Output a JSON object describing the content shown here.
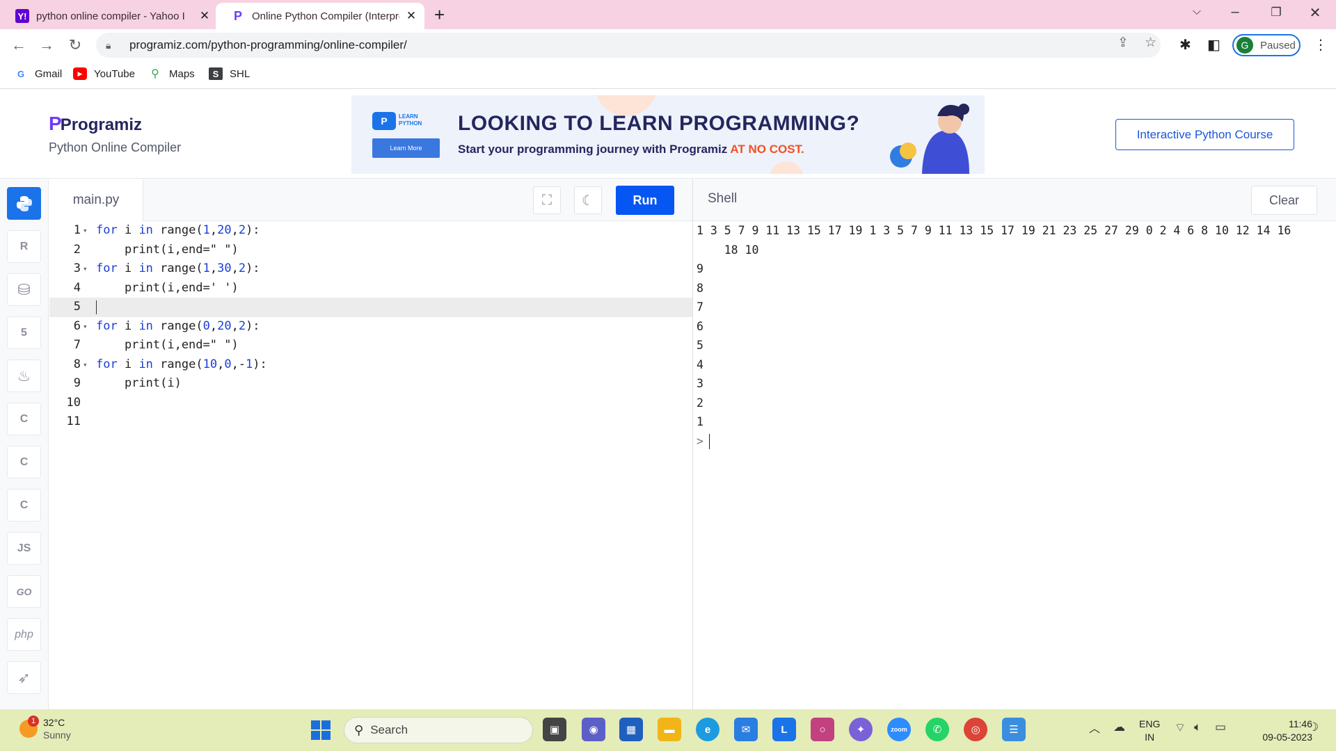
{
  "browser": {
    "tabs": [
      {
        "title": "python online compiler - Yahoo I",
        "favicon": "Y!",
        "active": false
      },
      {
        "title": "Online Python Compiler (Interpre",
        "favicon": "P",
        "active": true
      }
    ],
    "url": "programiz.com/python-programming/online-compiler/",
    "profile_initial": "G",
    "profile_status": "Paused",
    "bookmarks": [
      {
        "label": "Gmail",
        "icon": "google-icon"
      },
      {
        "label": "YouTube",
        "icon": "youtube-icon"
      },
      {
        "label": "Maps",
        "icon": "maps-icon"
      },
      {
        "label": "SHL",
        "icon": "shl-icon"
      }
    ]
  },
  "site": {
    "logo": "Programiz",
    "subtitle": "Python Online Compiler",
    "banner": {
      "badge_text": "LEARN PYTHON",
      "learn_button": "Learn More",
      "headline": "LOOKING TO LEARN PROGRAMMING?",
      "subline": "Start your programming journey with Programiz",
      "highlight": "AT NO COST."
    },
    "course_button": "Interactive Python Course"
  },
  "sidebar": {
    "languages": [
      {
        "name": "python",
        "label": "",
        "active": true
      },
      {
        "name": "r",
        "label": "R",
        "active": false
      },
      {
        "name": "sql",
        "label": "",
        "active": false
      },
      {
        "name": "html",
        "label": "5",
        "active": false
      },
      {
        "name": "java",
        "label": "",
        "active": false
      },
      {
        "name": "c",
        "label": "C",
        "active": false
      },
      {
        "name": "cpp",
        "label": "C",
        "active": false
      },
      {
        "name": "csharp",
        "label": "C",
        "active": false
      },
      {
        "name": "javascript",
        "label": "JS",
        "active": false
      },
      {
        "name": "go",
        "label": "GO",
        "active": false
      },
      {
        "name": "php",
        "label": "php",
        "active": false
      },
      {
        "name": "swift",
        "label": "",
        "active": false
      }
    ]
  },
  "editor": {
    "filename": "main.py",
    "run_label": "Run",
    "current_line": 5,
    "lines": [
      {
        "n": "1",
        "fold": true,
        "code": [
          {
            "t": "for",
            "c": "kw"
          },
          {
            "t": " i "
          },
          {
            "t": "in",
            "c": "kw"
          },
          {
            "t": " range("
          },
          {
            "t": "1",
            "c": "num"
          },
          {
            "t": ","
          },
          {
            "t": "20",
            "c": "num"
          },
          {
            "t": ","
          },
          {
            "t": "2",
            "c": "num"
          },
          {
            "t": "):"
          }
        ]
      },
      {
        "n": "2",
        "fold": false,
        "code": [
          {
            "t": "    print(i,end=\" \")"
          }
        ]
      },
      {
        "n": "3",
        "fold": true,
        "code": [
          {
            "t": "for",
            "c": "kw"
          },
          {
            "t": " i "
          },
          {
            "t": "in",
            "c": "kw"
          },
          {
            "t": " range("
          },
          {
            "t": "1",
            "c": "num"
          },
          {
            "t": ","
          },
          {
            "t": "30",
            "c": "num"
          },
          {
            "t": ","
          },
          {
            "t": "2",
            "c": "num"
          },
          {
            "t": "):"
          }
        ]
      },
      {
        "n": "4",
        "fold": false,
        "code": [
          {
            "t": "    print(i,end=' ')"
          }
        ]
      },
      {
        "n": "5",
        "fold": false,
        "code": []
      },
      {
        "n": "6",
        "fold": true,
        "code": [
          {
            "t": "for",
            "c": "kw"
          },
          {
            "t": " i "
          },
          {
            "t": "in",
            "c": "kw"
          },
          {
            "t": " range("
          },
          {
            "t": "0",
            "c": "num"
          },
          {
            "t": ","
          },
          {
            "t": "20",
            "c": "num"
          },
          {
            "t": ","
          },
          {
            "t": "2",
            "c": "num"
          },
          {
            "t": "):"
          }
        ]
      },
      {
        "n": "7",
        "fold": false,
        "code": [
          {
            "t": "    print(i,end=\" \")"
          }
        ]
      },
      {
        "n": "8",
        "fold": true,
        "code": [
          {
            "t": "for",
            "c": "kw"
          },
          {
            "t": " i "
          },
          {
            "t": "in",
            "c": "kw"
          },
          {
            "t": " range("
          },
          {
            "t": "10",
            "c": "num"
          },
          {
            "t": ","
          },
          {
            "t": "0",
            "c": "num"
          },
          {
            "t": ",-"
          },
          {
            "t": "1",
            "c": "num"
          },
          {
            "t": "):"
          }
        ]
      },
      {
        "n": "9",
        "fold": false,
        "code": [
          {
            "t": "    print(i)"
          }
        ]
      },
      {
        "n": "10",
        "fold": false,
        "code": []
      },
      {
        "n": "11",
        "fold": false,
        "code": []
      }
    ]
  },
  "shell": {
    "title": "Shell",
    "clear_label": "Clear",
    "output": [
      "1 3 5 7 9 11 13 15 17 19 1 3 5 7 9 11 13 15 17 19 21 23 25 27 29 0 2 4 6 8 10 12 14 16",
      "    18 10",
      "9",
      "8",
      "7",
      "6",
      "5",
      "4",
      "3",
      "2",
      "1"
    ],
    "prompt": ">"
  },
  "taskbar": {
    "temperature": "32°C",
    "condition": "Sunny",
    "weather_badge": "1",
    "search_placeholder": "Search",
    "language_line1": "ENG",
    "language_line2": "IN",
    "time": "11:46",
    "date": "09-05-2023"
  },
  "colors": {
    "tabstrip": "#f6d2e2",
    "run_button": "#0556f3",
    "keyword": "#1a3fd6",
    "taskbar": "#e4ecb8"
  }
}
